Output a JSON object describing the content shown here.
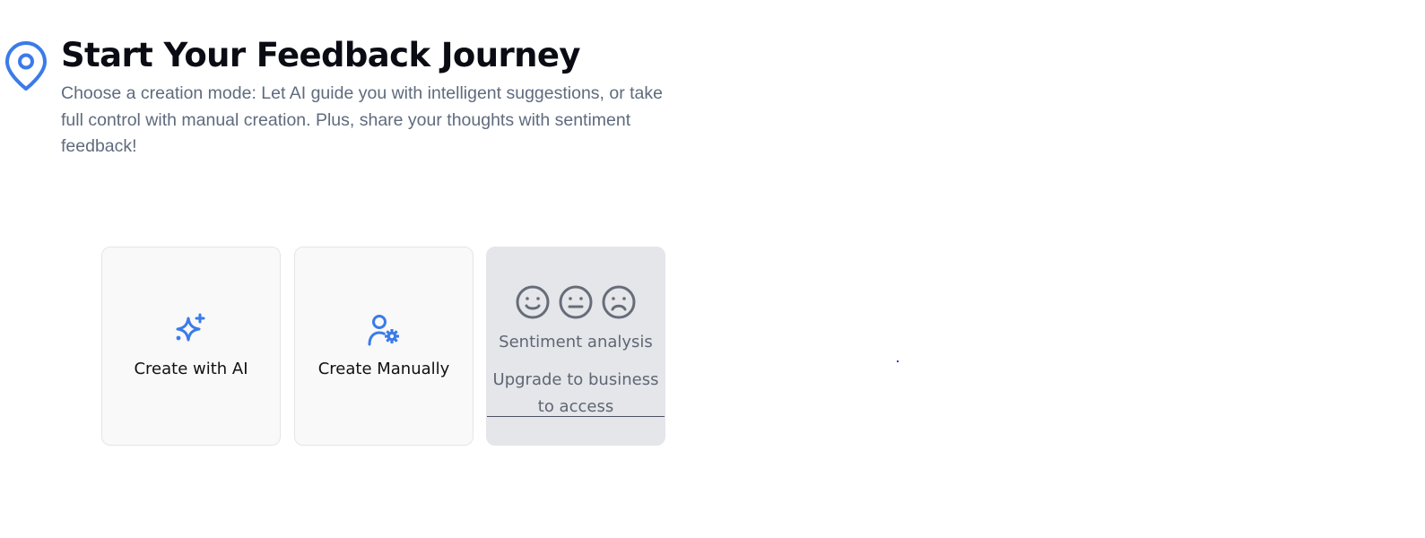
{
  "header": {
    "title": "Start Your Feedback Journey",
    "subtitle": "Choose a creation mode: Let AI guide you with intelligent suggestions, or take full control with manual creation. Plus, share your thoughts with sentiment feedback!",
    "icon": "map-pin-icon"
  },
  "cards": {
    "ai": {
      "label": "Create with AI",
      "icon": "sparkles-icon"
    },
    "manual": {
      "label": "Create Manually",
      "icon": "user-gear-icon"
    },
    "sentiment": {
      "label": "Sentiment analysis",
      "upgrade_text": "Upgrade to business to access",
      "icons": [
        "smile-icon",
        "neutral-face-icon",
        "frown-icon"
      ]
    }
  },
  "colors": {
    "accent": "#3b7be9",
    "title": "#0b0b14",
    "subtitle": "#5f6b7d",
    "card_bg": "#f9f9fa",
    "disabled_card_bg": "#e4e6ea",
    "disabled_text": "#5f6673"
  }
}
